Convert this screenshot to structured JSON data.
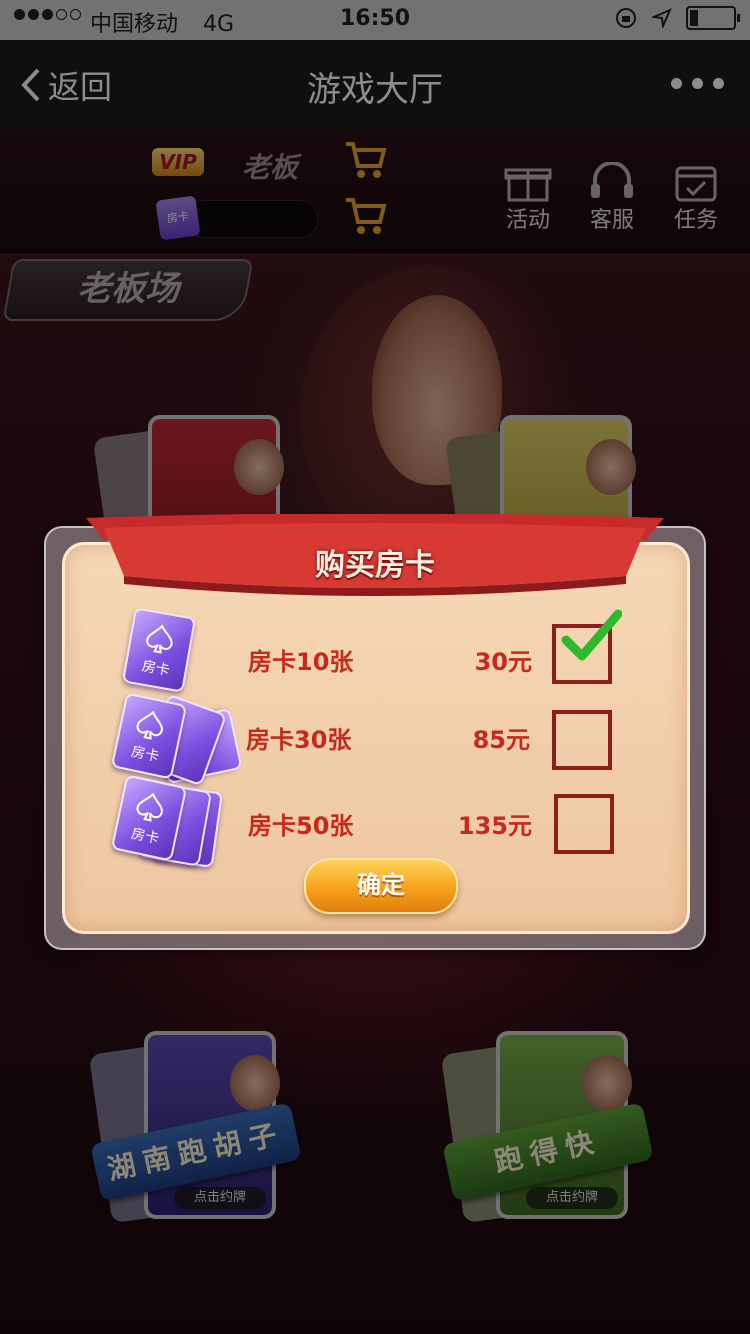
{
  "status_bar": {
    "carrier": "中国移动",
    "network": "4G",
    "time": "16:50"
  },
  "nav": {
    "back_label": "返回",
    "title": "游戏大厅"
  },
  "header": {
    "vip_badge": "VIP",
    "username": "老板",
    "room_card_label": "房卡",
    "buttons": [
      {
        "label": "活动",
        "icon": "gift-icon"
      },
      {
        "label": "客服",
        "icon": "headset-icon"
      },
      {
        "label": "任务",
        "icon": "calendar-icon"
      }
    ]
  },
  "room_tag": "老板场",
  "games": [
    {
      "label": "湖南跑胡子",
      "tap_hint": "点击约牌",
      "color": "#5d4ab8"
    },
    {
      "label": "跑得快",
      "tap_hint": "点击约牌",
      "color": "#7eae4c"
    }
  ],
  "dialog": {
    "title": "购买房卡",
    "card_icon_label": "房卡",
    "options": [
      {
        "label": "房卡10张",
        "price": "30元",
        "selected": true
      },
      {
        "label": "房卡30张",
        "price": "85元",
        "selected": false
      },
      {
        "label": "房卡50张",
        "price": "135元",
        "selected": false
      }
    ],
    "confirm_label": "确定"
  },
  "colors": {
    "accent_red": "#c52a1c",
    "checkbox_border": "#8e1e1a",
    "checkmark_green": "#2eb82e",
    "confirm_orange": "#f6a21c"
  }
}
